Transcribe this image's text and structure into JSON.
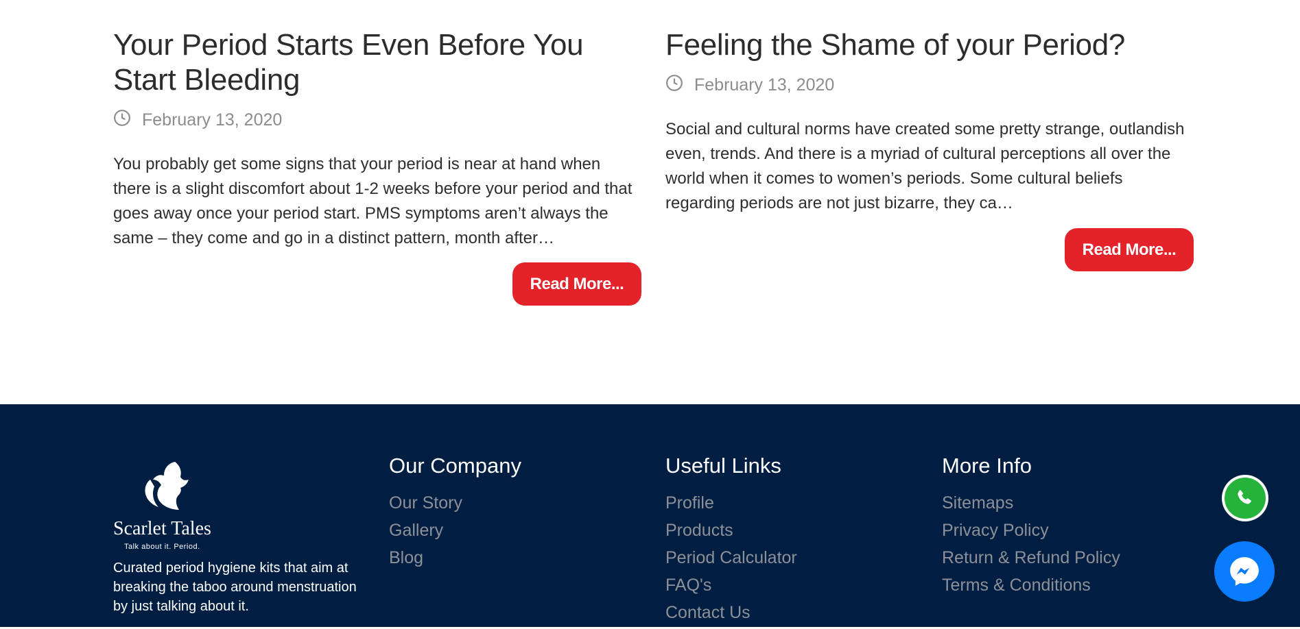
{
  "posts": [
    {
      "title": "Your Period Starts Even Before You Start Bleeding",
      "date": "February 13, 2020",
      "excerpt": "You probably get some signs that your period is near at hand when there is a slight discomfort about 1-2 weeks before your period and that goes away once your period start. PMS symptoms aren’t always the same – they come and go in a distinct pattern, month after…",
      "button": "Read More..."
    },
    {
      "title": "Feeling the Shame of your Period?",
      "date": "February 13, 2020",
      "excerpt": "Social and cultural norms have created some pretty strange, outlandish even, trends. And there is a myriad of cultural perceptions all over the world when it comes to women’s periods. Some cultural beliefs regarding periods are not just bizarre, they ca…",
      "button": "Read More..."
    }
  ],
  "footer": {
    "brand": {
      "name": "Scarlet Tales",
      "tagline": "Talk about it. Period.",
      "description": "Curated period hygiene kits that aim at breaking the taboo around menstruation by just talking about it."
    },
    "company": {
      "heading": "Our Company",
      "links": [
        "Our Story",
        "Gallery",
        "Blog"
      ]
    },
    "useful": {
      "heading": "Useful Links",
      "links": [
        "Profile",
        "Products",
        "Period Calculator",
        "FAQ's",
        "Contact Us"
      ]
    },
    "more": {
      "heading": "More Info",
      "links": [
        "Sitemaps",
        "Privacy Policy",
        "Return & Refund Policy",
        "Terms & Conditions"
      ]
    }
  },
  "floating": {
    "whatsapp_icon": "whatsapp-icon",
    "messenger_icon": "messenger-icon"
  },
  "colors": {
    "accent": "#e4222a",
    "footer_bg": "#001e42",
    "link_gray": "#8e9098",
    "whatsapp": "#25b33c",
    "messenger": "#0a7cff"
  }
}
